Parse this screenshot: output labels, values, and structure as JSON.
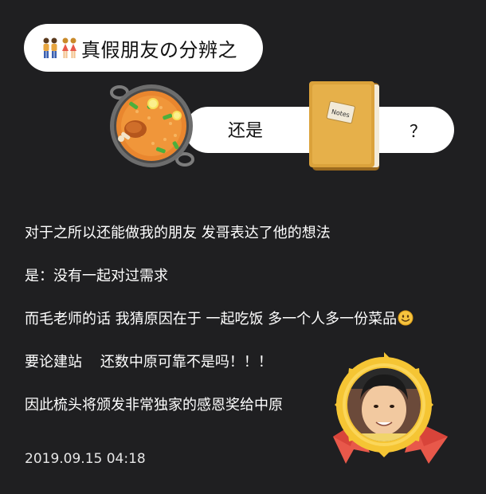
{
  "title": "真假朋友の分辨之",
  "compare": {
    "word": "还是",
    "question_mark": "？"
  },
  "icons": {
    "title_icon": "couples-icon",
    "left_item": "paella-icon",
    "right_item": "notebook-icon",
    "notebook_label": "Notes",
    "emoji": "slightly-smiling-face-icon",
    "badge": "award-medal-icon"
  },
  "lines": [
    "对于之所以还能做我的朋友 发哥表达了他的想法",
    "是：没有一起对过需求",
    "而毛老师的话 我猜原因在于 一起吃饭 多一个人多一份菜品",
    "要论建站    还数中原可靠不是吗！！！",
    "因此梳头将颁发非常独家的感恩奖给中原"
  ],
  "timestamp": "2019.09.15 04:18",
  "colors": {
    "background": "#1f1f21",
    "pill": "#ffffff",
    "medal_gold": "#f5c534",
    "ribbon": "#e8584a"
  }
}
